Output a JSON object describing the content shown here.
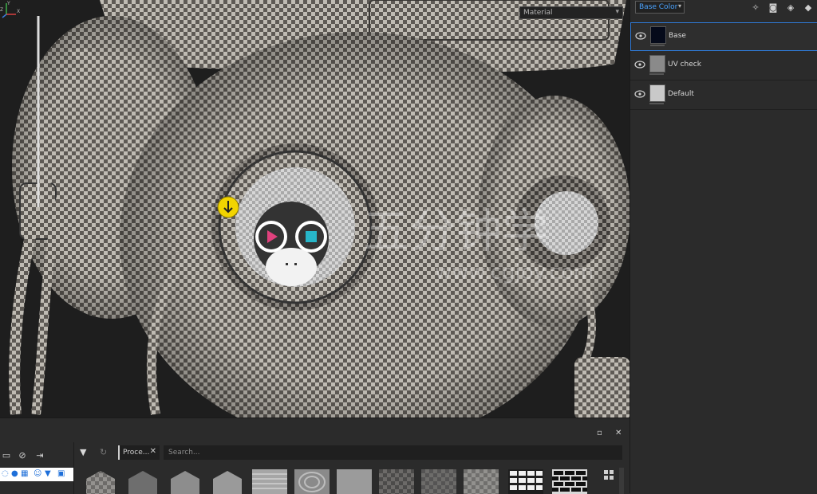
{
  "viewport": {
    "material_dropdown": "Material",
    "axes": {
      "x": "X",
      "y": "Y",
      "z": "Z"
    }
  },
  "layers_panel": {
    "channel_select": "Base Color",
    "toolbar_icons": [
      "magic-wand-icon",
      "add-mask-icon",
      "add-layer-icon",
      "add-fill-layer-icon"
    ],
    "layers": [
      {
        "name": "Base",
        "selected": true,
        "thumb_color": "#050a1a"
      },
      {
        "name": "UV check",
        "selected": false,
        "thumb_color": "#8a8a8a"
      },
      {
        "name": "Default",
        "selected": false,
        "thumb_color": "#c9c9c9"
      }
    ]
  },
  "shelf": {
    "header_icons": [
      "maximize-icon",
      "close-icon"
    ],
    "maximize_glyph": "▫",
    "close_glyph": "✕",
    "tag_chip": "Proce...",
    "tag_chip_close": "✕",
    "search_placeholder": "Search...",
    "left_tools": [
      "folder-icon",
      "hide-icon",
      "import-icon"
    ],
    "thumbnails": [
      "hex-noise",
      "hex-grain",
      "hex-marble",
      "hex-rock",
      "lines",
      "swirl",
      "flat-gray",
      "noise-dark-1",
      "noise-dark-2",
      "noise-light",
      "white-tiles",
      "black-bricks"
    ]
  },
  "colors": {
    "accent": "#2f7bd8",
    "accent_text": "#4aa3ff",
    "panel_bg": "#2b2b2b",
    "viewport_bg": "#1e1e1e"
  }
}
